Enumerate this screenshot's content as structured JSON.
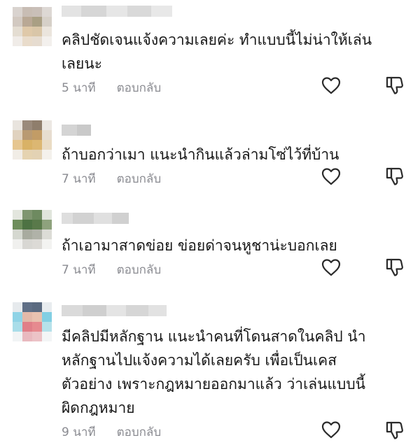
{
  "comments": [
    {
      "text": "คลิปชัดเจนแจ้งความเลยค่ะ ทำแบบนี้ไม่น่าให้เล่น\nเลยนะ",
      "time": "5 นาที",
      "reply_label": "ตอบกลับ",
      "icons": {
        "like": "heart-icon",
        "dislike": "thumbs-down-icon"
      }
    },
    {
      "text": "ถ้าบอกว่าเมา แนะนำกินแล้วล่ามโซ่ไว้ที่บ้าน",
      "time": "7 นาที",
      "reply_label": "ตอบกลับ",
      "icons": {
        "like": "heart-icon",
        "dislike": "thumbs-down-icon"
      }
    },
    {
      "text": "ถ้าเอามาสาดข่อย ข่อยด่าจนหูชาน่ะบอกเลย",
      "time": "7 นาที",
      "reply_label": "ตอบกลับ",
      "icons": {
        "like": "heart-icon",
        "dislike": "thumbs-down-icon"
      }
    },
    {
      "text": "มีคลิปมีหลักฐาน แนะนำคนที่โดนสาดในคลิป นำ\nหลักฐานไปแจ้งความได้เลยครับ เพื่อเป็นเคส\nตัวอย่าง เพราะกฎหมายออกมาแล้ว ว่าเล่นแบบนี้\nผิดกฎหมาย",
      "time": "9 นาที",
      "reply_label": "ตอบกลับ",
      "icons": {
        "like": "heart-icon",
        "dislike": "thumbs-down-icon"
      }
    }
  ],
  "colors": {
    "text": "#161616",
    "meta": "#8a8b91",
    "icon": "#2b2b2b"
  }
}
